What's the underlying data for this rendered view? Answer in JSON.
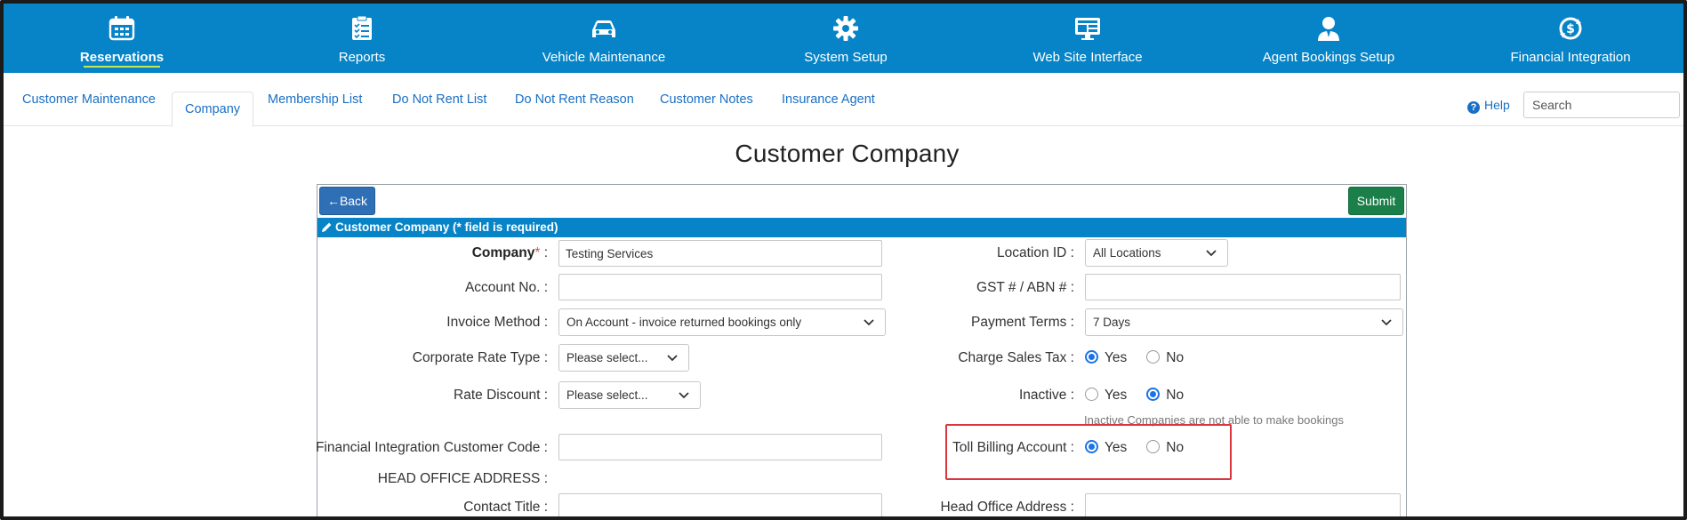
{
  "topnav": {
    "items": [
      {
        "label": "Reservations",
        "icon": "calendar-icon",
        "active": true
      },
      {
        "label": "Reports",
        "icon": "checklist-icon"
      },
      {
        "label": "Vehicle Maintenance",
        "icon": "car-icon"
      },
      {
        "label": "System Setup",
        "icon": "gear-icon"
      },
      {
        "label": "Web Site Interface",
        "icon": "monitor-icon"
      },
      {
        "label": "Agent Bookings Setup",
        "icon": "agent-icon"
      },
      {
        "label": "Financial Integration",
        "icon": "dollar-cycle-icon"
      }
    ]
  },
  "subtabs": {
    "items": [
      {
        "label": "Customer Maintenance"
      },
      {
        "label": "Company",
        "active": true
      },
      {
        "label": "Membership List"
      },
      {
        "label": "Do Not Rent List"
      },
      {
        "label": "Do Not Rent Reason"
      },
      {
        "label": "Customer Notes"
      },
      {
        "label": "Insurance Agent"
      }
    ],
    "help_label": "Help",
    "search_placeholder": "Search"
  },
  "page": {
    "title": "Customer Company",
    "back_label": "Back",
    "submit_label": "Submit",
    "panel_title": "Customer Company (* field is required)"
  },
  "form": {
    "company": {
      "label": "Company",
      "required_mark": "*",
      "colon": ":",
      "value": "Testing Services"
    },
    "account_no": {
      "label": "Account No. :",
      "value": ""
    },
    "invoice_method": {
      "label": "Invoice Method :",
      "value": "On Account - invoice returned bookings only"
    },
    "corporate_rate_type": {
      "label": "Corporate Rate Type :",
      "value": "Please select..."
    },
    "rate_discount": {
      "label": "Rate Discount :",
      "value": "Please select..."
    },
    "fi_customer_code": {
      "label": "Financial Integration Customer Code :",
      "value": ""
    },
    "head_office_address_heading": "HEAD OFFICE ADDRESS :",
    "contact_title": {
      "label": "Contact Title :",
      "value": ""
    },
    "location_id": {
      "label": "Location ID :",
      "value": "All Locations"
    },
    "gst_abn": {
      "label": "GST # / ABN # :",
      "value": ""
    },
    "payment_terms": {
      "label": "Payment Terms :",
      "value": "7 Days"
    },
    "charge_sales_tax": {
      "label": "Charge Sales Tax :",
      "yes": "Yes",
      "no": "No",
      "selected": "Yes"
    },
    "inactive": {
      "label": "Inactive :",
      "yes": "Yes",
      "no": "No",
      "selected": "No",
      "hint": "Inactive Companies are not able to make bookings"
    },
    "toll_billing_account": {
      "label": "Toll Billing Account :",
      "yes": "Yes",
      "no": "No",
      "selected": "Yes"
    },
    "head_office_address": {
      "label": "Head Office Address :",
      "value": ""
    }
  },
  "colors": {
    "nav_bg": "#0784c7",
    "active_underline": "#c6e65a",
    "back_button": "#2f6fb6",
    "submit_button": "#1b7f4a",
    "radio_selected": "#1a73e8",
    "highlight_box": "#d9363e"
  }
}
